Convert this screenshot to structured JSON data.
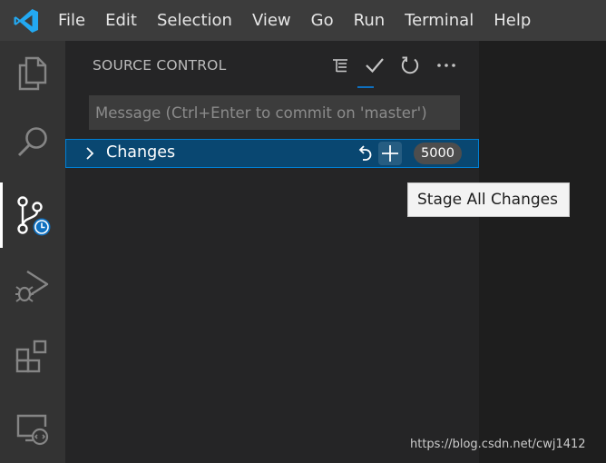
{
  "menubar": {
    "items": [
      "File",
      "Edit",
      "Selection",
      "View",
      "Go",
      "Run",
      "Terminal",
      "Help"
    ]
  },
  "activitybar": {
    "items": [
      {
        "icon": "files-icon"
      },
      {
        "icon": "search-icon"
      },
      {
        "icon": "source-control-icon",
        "active": true
      },
      {
        "icon": "run-debug-icon"
      },
      {
        "icon": "extensions-icon"
      },
      {
        "icon": "remote-explorer-icon"
      }
    ]
  },
  "sidebar": {
    "title": "SOURCE CONTROL",
    "actions": [
      "tree-view-icon",
      "commit-check-icon",
      "refresh-icon",
      "more-actions-icon"
    ],
    "commit_message": {
      "value": "",
      "placeholder": "Message (Ctrl+Enter to commit on 'master')"
    },
    "changes": {
      "label": "Changes",
      "count": "5000",
      "actions": [
        "discard-all-icon",
        "stage-all-plus-icon"
      ]
    }
  },
  "tooltip": {
    "text": "Stage All Changes"
  },
  "watermark": "https://blog.csdn.net/cwj1412",
  "colors": {
    "accent": "#0e70c0",
    "selection_row": "#094771",
    "focus_border": "#007fd4",
    "vscode_blue": "#23a9f2"
  }
}
